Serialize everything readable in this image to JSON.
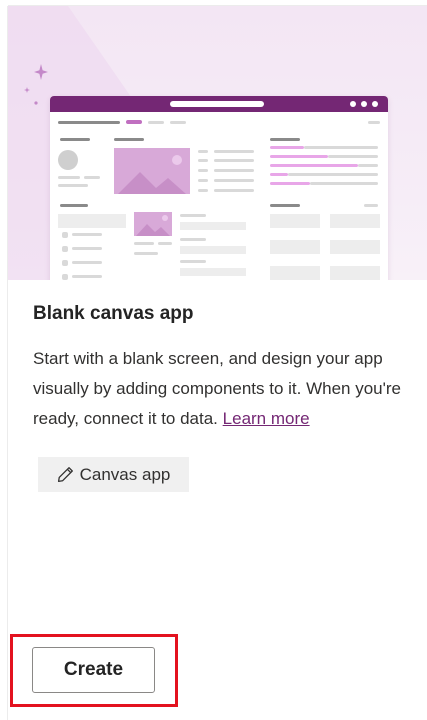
{
  "card": {
    "title": "Blank canvas app",
    "description": "Start with a blank screen, and design your app visually by adding components to it. When you're ready, connect it to data.",
    "learn_more": "Learn more",
    "tag_label": "Canvas app",
    "tag_icon": "pencil-icon",
    "create_label": "Create"
  },
  "colors": {
    "brand": "#742774",
    "hero_bg": "#f3e6f4",
    "highlight": "#e3121f",
    "tag_bg": "#f0f0f0"
  }
}
